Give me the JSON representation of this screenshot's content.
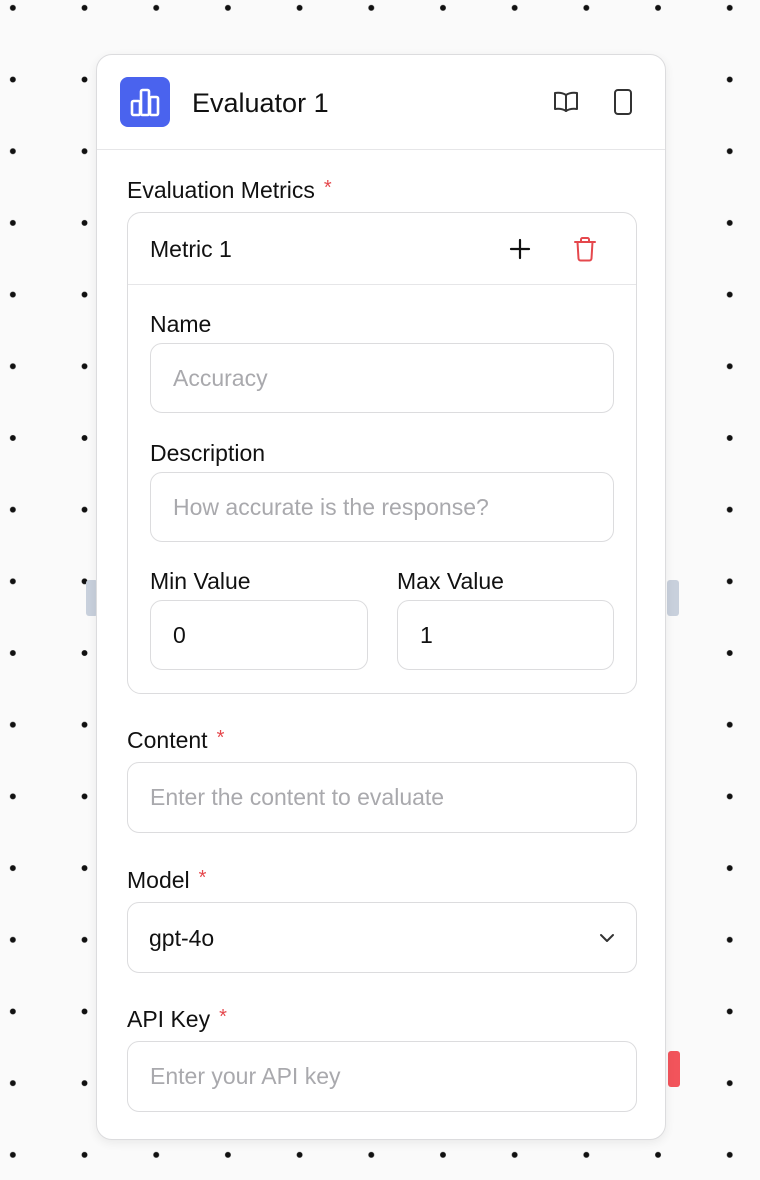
{
  "node": {
    "title": "Evaluator 1",
    "icon": "bar-chart-icon",
    "accent_color": "#4a63ee",
    "header_actions": [
      "book-open-icon",
      "phone-icon"
    ]
  },
  "evaluation_metrics": {
    "label": "Evaluation Metrics",
    "required_mark": "*",
    "metric": {
      "title": "Metric 1",
      "actions": [
        "plus-icon",
        "trash-icon"
      ],
      "name": {
        "label": "Name",
        "value": "",
        "placeholder": "Accuracy"
      },
      "description": {
        "label": "Description",
        "value": "",
        "placeholder": "How accurate is the response?"
      },
      "min_value": {
        "label": "Min Value",
        "value": "0"
      },
      "max_value": {
        "label": "Max Value",
        "value": "1"
      }
    }
  },
  "content": {
    "label": "Content",
    "required_mark": "*",
    "value": "",
    "placeholder": "Enter the content to evaluate"
  },
  "model": {
    "label": "Model",
    "required_mark": "*",
    "selected": "gpt-4o"
  },
  "api_key": {
    "label": "API Key",
    "required_mark": "*",
    "value": "",
    "placeholder": "Enter your API key"
  },
  "colors": {
    "required": "#e5484d",
    "delete": "#e5484d",
    "handle": "#c8d0dc",
    "error_handle": "#f2545b"
  }
}
